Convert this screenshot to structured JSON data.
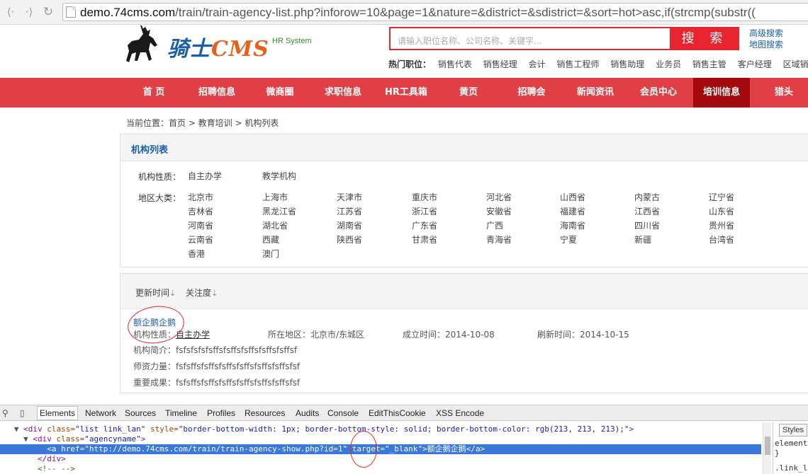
{
  "browser": {
    "url_host": "demo.74cms.com",
    "url_rest": "/train/train-agency-list.php?inforow=10&page=1&nature=&district=&sdistrict=&sort=hot>asc,if(strcmp(substr(("
  },
  "header": {
    "brand_cn": "骑士",
    "brand_en": "CMS",
    "brand_tag": "HR System",
    "search_placeholder": "请输入职位名称、公司名称、关键字...",
    "search_button": "搜 索",
    "advanced_search": "高级搜索",
    "map_search": "地图搜索",
    "hot_label": "热门职位：",
    "hot_jobs": [
      "销售代表",
      "销售经理",
      "会计",
      "销售工程师",
      "销售助理",
      "业务员",
      "销售主管",
      "客户经理",
      "区域销售"
    ]
  },
  "nav": [
    "首 页",
    "招聘信息",
    "微商圈",
    "求职信息",
    "HR工具箱",
    "黄页",
    "招聘会",
    "新闻资讯",
    "会员中心",
    "培训信息",
    "猎头"
  ],
  "breadcrumb": "当前位置：首页 > 教育培训 > 机构列表",
  "filter": {
    "title": "机构列表",
    "nature_label": "机构性质：",
    "nature_options": [
      "自主办学",
      "教学机构"
    ],
    "region_label": "地区大类：",
    "regions": [
      "北京市",
      "上海市",
      "天津市",
      "重庆市",
      "河北省",
      "山西省",
      "内蒙古",
      "辽宁省",
      "吉林省",
      "黑龙江省",
      "江苏省",
      "浙江省",
      "安徽省",
      "福建省",
      "江西省",
      "山东省",
      "河南省",
      "湖北省",
      "湖南省",
      "广东省",
      "广西",
      "海南省",
      "四川省",
      "贵州省",
      "云南省",
      "西藏",
      "陕西省",
      "甘肃省",
      "青海省",
      "宁夏",
      "新疆",
      "台湾省",
      "香港",
      "澳门"
    ]
  },
  "sort": {
    "updated": "更新时间",
    "attention": "关注度",
    "arrow": "⇣"
  },
  "agency": {
    "name": "额企鹅企鹅",
    "nature_label": "机构性质：",
    "nature_value": "自主办学",
    "location": "所在地区：北京市/东城区",
    "founded": "成立时间：2014-10-08",
    "refreshed": "刷新时间：2014-10-15",
    "intro": "机构简介：fsfsfsfsfsffsfsffsfsffsfsffsfsffsf",
    "teachers": "师资力量：fsfsffsfsffsfsffsfsffsfsffsfsffsfsf",
    "results": "重要成果：fsfsffsfsffsfsffsfsffsfsffsfsffsfsf"
  },
  "devtools": {
    "tabs": [
      "Elements",
      "Network",
      "Sources",
      "Timeline",
      "Profiles",
      "Resources",
      "Audits",
      "Console",
      "EditThisCookie",
      "XSS Encode"
    ],
    "line1_tag": "<div ",
    "line1_a1": "class=",
    "line1_v1": "\"list link_lan\"",
    "line1_a2": " style=",
    "line1_v2": "\"border-bottom-width: 1px; border-bottom-style: solid; border-bottom-color: rgb(213, 213, 213);\"",
    "line1_end": ">",
    "line2_tag": "<div ",
    "line2_a1": "class=",
    "line2_v1": "\"agencyname\"",
    "line2_end": ">",
    "line3": "<a href=\"http://demo.74cms.com/train/train-agency-show.php?id=1\" target=\"_blank\">额企鹅企鹅</a>",
    "line4": "</div>",
    "line5": "<!-- -->",
    "styles_btn": "Styles",
    "styles_line1": "element",
    "styles_line2": "}",
    "styles_line3": ".link_l"
  }
}
